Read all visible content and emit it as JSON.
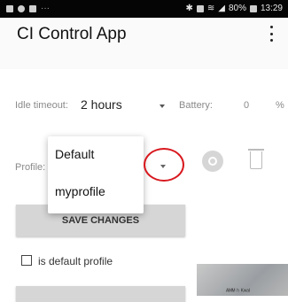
{
  "status_bar": {
    "right_text": "80%",
    "time": "13:29"
  },
  "app": {
    "title": "CI Control App"
  },
  "form": {
    "idle_timeout": {
      "label": "Idle timeout:",
      "value": "2 hours"
    },
    "battery": {
      "label": "Battery:",
      "value": "0",
      "unit": "%"
    },
    "profile": {
      "label": "Profile:"
    },
    "save_label": "SAVE CHANGES",
    "default_checkbox_label": "is default profile"
  },
  "profile_menu": {
    "options": [
      "Default",
      "myprofile"
    ]
  },
  "photo_caption": "ᴬᴹᴹ ʰ ᴷʷᵃᴵ"
}
